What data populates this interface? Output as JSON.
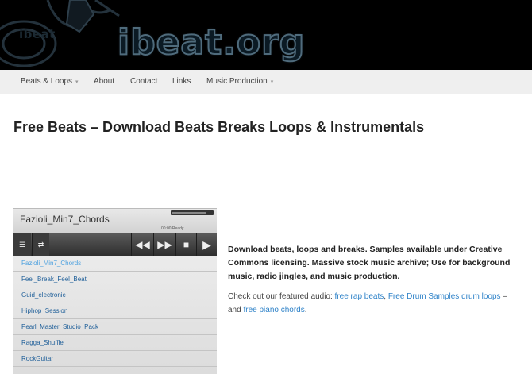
{
  "header": {
    "logo_small": "ibeat",
    "logo_main": "ibeat.org"
  },
  "nav": {
    "items": [
      {
        "label": "Beats & Loops",
        "has_dropdown": true
      },
      {
        "label": "About",
        "has_dropdown": false
      },
      {
        "label": "Contact",
        "has_dropdown": false
      },
      {
        "label": "Links",
        "has_dropdown": false
      },
      {
        "label": "Music Production",
        "has_dropdown": true
      }
    ]
  },
  "page": {
    "title": "Free Beats – Download Beats Breaks Loops & Instrumentals"
  },
  "player": {
    "track_name": "Fazioli_Min7_Chords",
    "status": "00:00 Ready",
    "volume": 0.85,
    "playlist": [
      "Fazioli_Min7_Chords",
      "Feel_Break_Feel_Beat",
      "Guid_electronic",
      "Hiphop_Session",
      "Pearl_Master_Studio_Pack",
      "Ragga_Shuffle",
      "RockGuitar"
    ],
    "active_index": 0
  },
  "description": {
    "text": "Download beats, loops and breaks. Samples available under Creative Commons licensing. Massive stock music archive; Use for background music, radio jingles, and music production."
  },
  "featured": {
    "prefix": "Check out our featured audio:",
    "link1": "free rap beats",
    "sep1": ",",
    "link2": "Free Drum Samples drum loops",
    "sep2": " – and",
    "link3": "free piano chords",
    "suffix": "."
  },
  "colors": {
    "banner_bg": "#000000",
    "nav_bg": "#efefef",
    "link": "#2e82c8",
    "playlist_link": "#1f5f99",
    "playlist_active": "#4ba0df"
  }
}
